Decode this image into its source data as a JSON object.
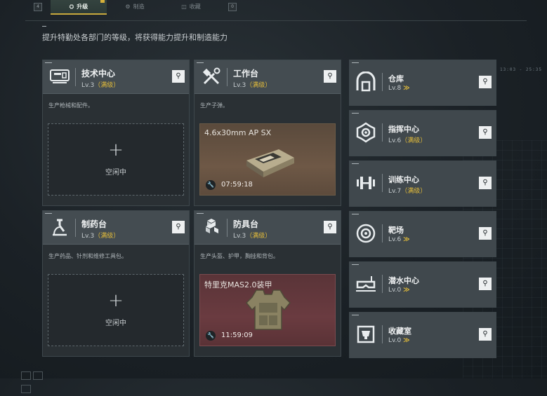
{
  "tabs": [
    {
      "label": "升级",
      "icon": "upgrade-icon",
      "active": true
    },
    {
      "label": "制造",
      "icon": "craft-icon",
      "active": false
    },
    {
      "label": "收藏",
      "icon": "collection-icon",
      "active": false
    }
  ],
  "keyhints": {
    "left": "4",
    "right": "0"
  },
  "subtitle": "提升特勤处各部门的等级，将获得能力提升和制造能力",
  "hud_time": "13:03 - 25:35",
  "facilities": [
    {
      "name": "技术中心",
      "level": "Lv.3",
      "status": "（满级）",
      "icon": "tech-center-icon",
      "desc": "生产枪械和配件。",
      "slot": {
        "state": "idle",
        "label": "空闲中"
      }
    },
    {
      "name": "工作台",
      "level": "Lv.3",
      "status": "（满级）",
      "icon": "workbench-icon",
      "desc": "生产子弹。",
      "slot": {
        "state": "crafting",
        "item": "4.6x30mm AP SX",
        "timer": "07:59:18"
      }
    },
    {
      "name": "制药台",
      "level": "Lv.3",
      "status": "（满级）",
      "icon": "pharmacy-icon",
      "desc": "生产药品、针剂和维修工具包。",
      "slot": {
        "state": "idle",
        "label": "空闲中"
      }
    },
    {
      "name": "防具台",
      "level": "Lv.3",
      "status": "（满级）",
      "icon": "armor-bench-icon",
      "desc": "生产头盔、护甲，胸挂和背包。",
      "slot": {
        "state": "crafting",
        "item": "特里克MAS2.0装甲",
        "timer": "11:59:09"
      }
    }
  ],
  "side_facilities": [
    {
      "name": "仓库",
      "level": "Lv.8",
      "status": "",
      "upgrade": "≫",
      "icon": "warehouse-icon"
    },
    {
      "name": "指挥中心",
      "level": "Lv.6",
      "status": "（满级）",
      "upgrade": "",
      "icon": "command-center-icon"
    },
    {
      "name": "训练中心",
      "level": "Lv.7",
      "status": "（满级）",
      "upgrade": "",
      "icon": "training-center-icon"
    },
    {
      "name": "靶场",
      "level": "Lv.6",
      "status": "",
      "upgrade": "≫",
      "icon": "shooting-range-icon"
    },
    {
      "name": "潜水中心",
      "level": "Lv.0",
      "status": "",
      "upgrade": "≫",
      "icon": "diving-center-icon"
    },
    {
      "name": "收藏室",
      "level": "Lv.0",
      "status": "",
      "upgrade": "≫",
      "icon": "collection-room-icon"
    }
  ]
}
